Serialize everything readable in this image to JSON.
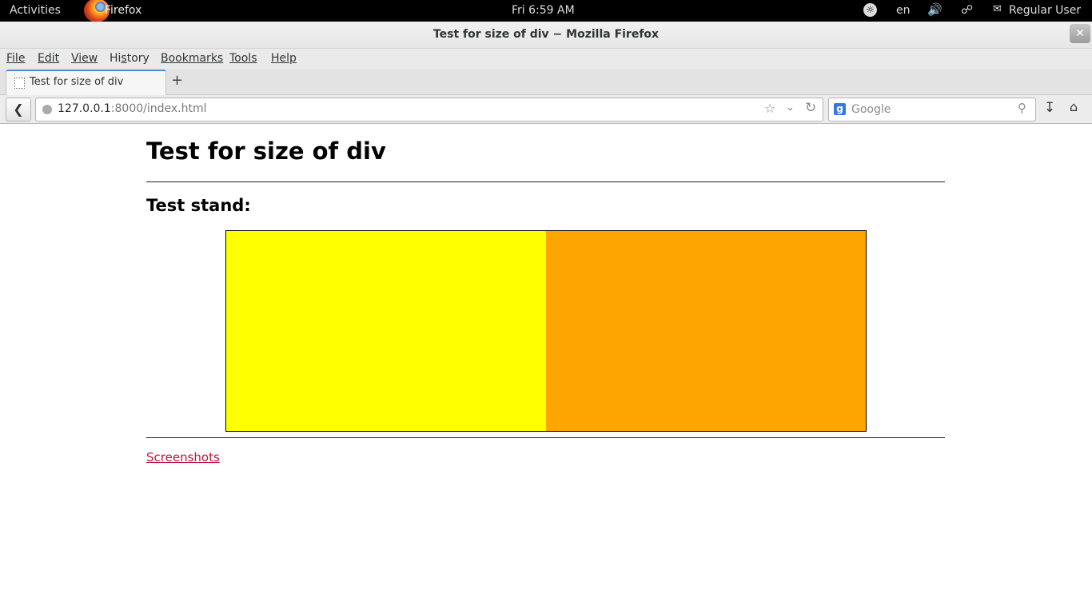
{
  "topbar": {
    "activities": "Activities",
    "app_name": "Firefox",
    "clock": "Fri  6:59 AM",
    "language": "en",
    "user": "Regular User"
  },
  "window": {
    "title": "Test for size of div − Mozilla Firefox"
  },
  "menubar": {
    "items": [
      "File",
      "Edit",
      "View",
      "History",
      "Bookmarks",
      "Tools",
      "Help"
    ],
    "mnemonics": [
      "F",
      "E",
      "V",
      "s",
      "B",
      "T",
      "H"
    ]
  },
  "tabs": [
    {
      "label": "Test for size of div",
      "active": true
    }
  ],
  "navbar": {
    "url_host": "127.0.0.1",
    "url_rest": ":8000/index.html",
    "search_placeholder": "Google"
  },
  "page": {
    "heading": "Test for size of div",
    "subheading": "Test stand:",
    "stand_colors": {
      "left": "#ffff00",
      "right": "#ffa500"
    },
    "link_text": "Screenshots"
  },
  "icons": {
    "back": "chevron-left",
    "star": "bookmark-star",
    "reload": "reload",
    "search": "magnifier",
    "downloads": "download-arrow",
    "home": "home"
  }
}
